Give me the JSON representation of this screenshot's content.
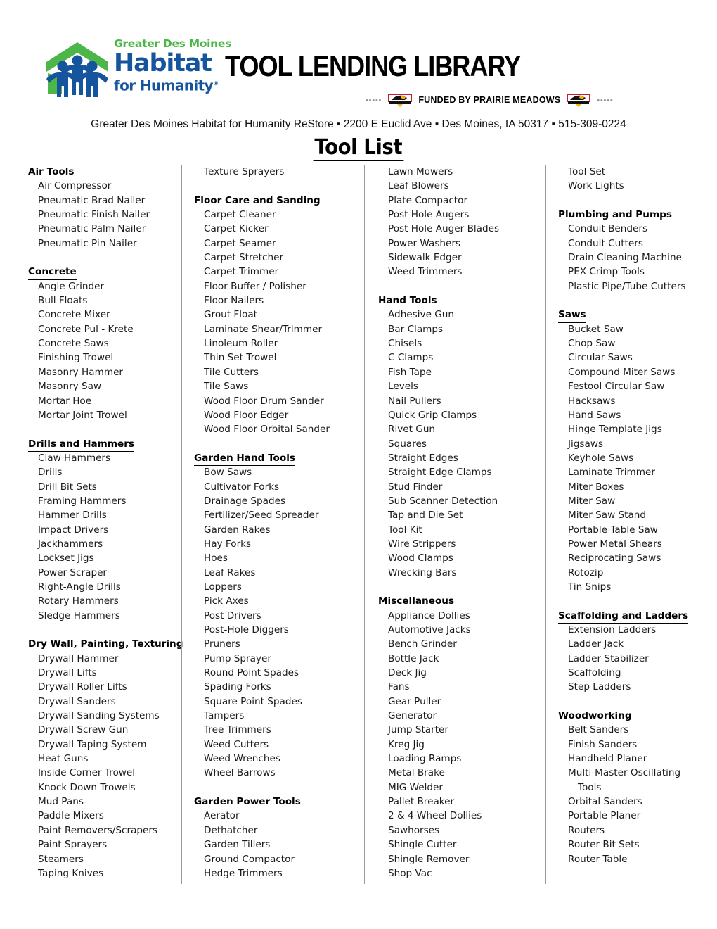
{
  "header": {
    "org_logo": {
      "line1": "Greater Des Moines",
      "line2": "Habitat",
      "line3": "for Humanity",
      "registered_mark": "®",
      "green": "#4cb648",
      "blue": "#15559e"
    },
    "title": "TOOL LENDING LIBRARY",
    "funded_dash_left": "-----",
    "funded_by": "FUNDED BY PRAIRIE MEADOWS",
    "funded_dash_right": "-----",
    "address_line": "Greater Des Moines Habitat for Humanity ReStore ▪ 2200 E Euclid Ave ▪ Des Moines, IA 50317 ▪ 515-309-0224",
    "page_title": "Tool List"
  },
  "columns": [
    {
      "id": "column-1",
      "blocks": [
        {
          "type": "category",
          "label": "Air Tools",
          "items": [
            "Air Compressor",
            "Pneumatic Brad Nailer",
            "Pneumatic Finish Nailer",
            "Pneumatic Palm Nailer",
            "Pneumatic Pin Nailer"
          ]
        },
        {
          "type": "spacer"
        },
        {
          "type": "category",
          "label": "Concrete",
          "items": [
            "Angle Grinder",
            "Bull Floats",
            "Concrete Mixer",
            "Concrete Pul - Krete",
            "Concrete Saws",
            "Finishing Trowel",
            "Masonry Hammer",
            "Masonry Saw",
            "Mortar Hoe",
            "Mortar Joint Trowel"
          ]
        },
        {
          "type": "spacer"
        },
        {
          "type": "category",
          "label": "Drills and Hammers",
          "items": [
            "Claw Hammers",
            "Drills",
            "Drill Bit Sets",
            "Framing Hammers",
            "Hammer Drills",
            "Impact Drivers",
            "Jackhammers",
            "Lockset Jigs",
            "Power Scraper",
            "Right-Angle Drills",
            "Rotary Hammers",
            "Sledge Hammers"
          ]
        },
        {
          "type": "spacer"
        },
        {
          "type": "category",
          "label": "Dry Wall, Painting, Texturing",
          "items": [
            "Drywall Hammer",
            "Drywall Lifts",
            "Drywall Roller Lifts",
            "Drywall Sanders",
            "Drywall Sanding Systems",
            "Drywall Screw Gun",
            "Drywall Taping System",
            "Heat Guns",
            "Inside Corner Trowel",
            "Knock Down Trowels",
            "Mud Pans",
            "Paddle Mixers",
            "Paint Removers/Scrapers",
            "Paint Sprayers",
            "Steamers",
            "Taping Knives"
          ]
        }
      ]
    },
    {
      "id": "column-2",
      "blocks": [
        {
          "type": "items",
          "items": [
            "Texture Sprayers"
          ]
        },
        {
          "type": "spacer"
        },
        {
          "type": "category",
          "label": "Floor Care and Sanding",
          "items": [
            "Carpet Cleaner",
            "Carpet Kicker",
            "Carpet Seamer",
            "Carpet Stretcher",
            "Carpet Trimmer",
            "Floor Buffer / Polisher",
            "Floor Nailers",
            "Grout Float",
            "Laminate Shear/Trimmer",
            "Linoleum Roller",
            "Thin Set Trowel",
            "Tile Cutters",
            "Tile Saws",
            "Wood Floor Drum Sander",
            "Wood Floor Edger",
            "Wood Floor Orbital Sander"
          ]
        },
        {
          "type": "spacer"
        },
        {
          "type": "category",
          "label": "Garden Hand Tools",
          "items": [
            "Bow Saws",
            "Cultivator Forks",
            "Drainage Spades",
            "Fertilizer/Seed Spreader",
            "Garden Rakes",
            "Hay Forks",
            "Hoes",
            "Leaf Rakes",
            "Loppers",
            "Pick Axes",
            "Post Drivers",
            "Post-Hole Diggers",
            "Pruners",
            "Pump Sprayer",
            "Round Point Spades",
            "Spading Forks",
            "Square Point Spades",
            "Tampers",
            "Tree Trimmers",
            "Weed Cutters",
            "Weed Wrenches",
            "Wheel Barrows"
          ]
        },
        {
          "type": "spacer"
        },
        {
          "type": "category",
          "label": "Garden Power Tools",
          "items": [
            "Aerator",
            "Dethatcher",
            "Garden Tillers",
            "Ground Compactor",
            "Hedge Trimmers"
          ]
        }
      ]
    },
    {
      "id": "column-3",
      "blocks": [
        {
          "type": "items",
          "items": [
            "Lawn Mowers",
            "Leaf Blowers",
            "Plate Compactor",
            "Post Hole Augers",
            "Post Hole Auger Blades",
            "Power Washers",
            "Sidewalk Edger",
            "Weed Trimmers"
          ]
        },
        {
          "type": "spacer"
        },
        {
          "type": "category",
          "label": "Hand Tools",
          "items": [
            "Adhesive Gun",
            "Bar Clamps",
            "Chisels",
            "C Clamps",
            "Fish Tape",
            "Levels",
            "Nail Pullers",
            "Quick Grip Clamps",
            "Rivet Gun",
            "Squares",
            "Straight Edges",
            "Straight Edge Clamps",
            "Stud Finder",
            "Sub Scanner Detection",
            "Tap and Die Set",
            "Tool Kit",
            "Wire Strippers",
            "Wood Clamps",
            "Wrecking Bars"
          ]
        },
        {
          "type": "spacer"
        },
        {
          "type": "category",
          "label": "Miscellaneous",
          "items": [
            "Appliance Dollies",
            "Automotive Jacks",
            "Bench Grinder",
            "Bottle Jack",
            "Deck Jig",
            "Fans",
            "Gear Puller",
            "Generator",
            "Jump Starter",
            "Kreg Jig",
            "Loading Ramps",
            "Metal Brake",
            "MIG Welder",
            "Pallet Breaker",
            "2 & 4-Wheel Dollies",
            "Sawhorses",
            "Shingle Cutter",
            "Shingle Remover",
            "Shop Vac"
          ]
        }
      ]
    },
    {
      "id": "column-4",
      "blocks": [
        {
          "type": "items",
          "items": [
            "Tool Set",
            "Work Lights"
          ]
        },
        {
          "type": "spacer"
        },
        {
          "type": "category",
          "label": "Plumbing and Pumps",
          "items": [
            "Conduit Benders",
            "Conduit Cutters",
            "Drain Cleaning Machine",
            "PEX Crimp Tools",
            "Plastic Pipe/Tube Cutters"
          ]
        },
        {
          "type": "spacer"
        },
        {
          "type": "category",
          "label": "Saws",
          "items": [
            "Bucket Saw",
            "Chop Saw",
            "Circular Saws",
            "Compound Miter Saws",
            "Festool Circular Saw",
            "Hacksaws",
            "Hand Saws",
            "Hinge Template Jigs",
            "Jigsaws",
            "Keyhole Saws",
            "Laminate Trimmer",
            "Miter Boxes",
            "Miter Saw",
            "Miter Saw Stand",
            "Portable Table Saw",
            "Power Metal Shears",
            "Reciprocating Saws",
            "Rotozip",
            "Tin Snips"
          ]
        },
        {
          "type": "spacer"
        },
        {
          "type": "category",
          "label": "Scaffolding and Ladders",
          "items": [
            "Extension Ladders",
            "Ladder Jack",
            "Ladder Stabilizer",
            "Scaffolding",
            "Step Ladders"
          ]
        },
        {
          "type": "spacer"
        },
        {
          "type": "category",
          "label": "Woodworking",
          "items": [
            "Belt Sanders",
            "Finish Sanders",
            "Handheld Planer",
            "Multi-Master Oscillating",
            "Tools",
            "Orbital Sanders",
            "Portable Planer",
            "Routers",
            "Router Bit Sets",
            "Router Table"
          ],
          "continuation_indices": [
            4
          ]
        }
      ]
    }
  ]
}
